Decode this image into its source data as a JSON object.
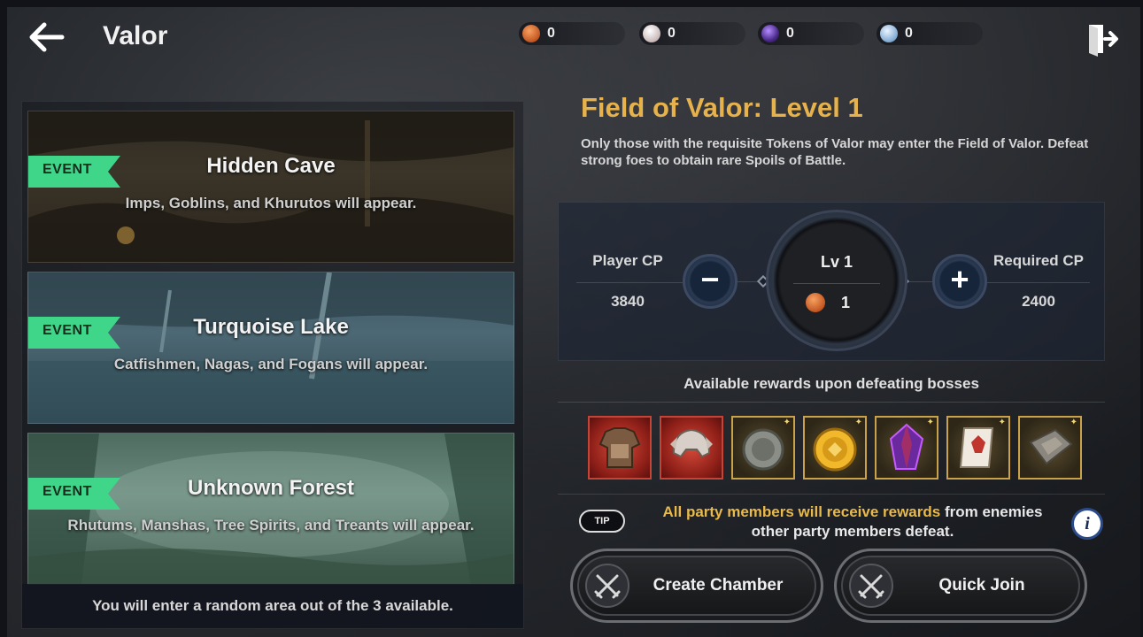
{
  "header": {
    "title": "Valor",
    "currencies": [
      {
        "icon": "valor-token-icon",
        "color": "#d1692b",
        "value": "0"
      },
      {
        "icon": "pearl-icon",
        "color": "#d8c8c8",
        "value": "0"
      },
      {
        "icon": "dark-orb-icon",
        "color": "#4a2a8a",
        "value": "0"
      },
      {
        "icon": "silver-coin-icon",
        "color": "#9fc2e4",
        "value": "0"
      }
    ]
  },
  "areas": [
    {
      "tag": "EVENT",
      "name": "Hidden Cave",
      "desc": "Imps, Goblins, and Khurutos will appear."
    },
    {
      "tag": "EVENT",
      "name": "Turquoise Lake",
      "desc": "Catfishmen, Nagas, and Fogans will appear."
    },
    {
      "tag": "EVENT",
      "name": "Unknown Forest",
      "desc": "Rhutums, Manshas, Tree Spirits, and Treants will appear."
    }
  ],
  "left_footer": "You will enter a random area out of the 3 available.",
  "level": {
    "title": "Field of Valor: Level 1",
    "description": "Only those with the requisite Tokens of Valor may enter the Field of Valor. Defeat strong foes to obtain rare Spoils of Battle.",
    "player_cp_label": "Player CP",
    "player_cp": "3840",
    "required_cp_label": "Required CP",
    "required_cp": "2400",
    "lv_label": "Lv 1",
    "cost": "1",
    "minus": "−",
    "plus": "+"
  },
  "rewards": {
    "title": "Available rewards upon defeating bosses",
    "items": [
      {
        "icon": "armor-chest-icon",
        "rarity": "red"
      },
      {
        "icon": "helmet-icon",
        "rarity": "red"
      },
      {
        "icon": "silver-medal-icon",
        "rarity": "gold"
      },
      {
        "icon": "gold-medal-icon",
        "rarity": "gold"
      },
      {
        "icon": "purple-crystal-icon",
        "rarity": "gold"
      },
      {
        "icon": "scroll-icon",
        "rarity": "gold"
      },
      {
        "icon": "stone-tablet-icon",
        "rarity": "gold"
      }
    ]
  },
  "tip": {
    "badge": "TIP",
    "highlight": "All party members will receive rewards",
    "rest_line1": " from enemies",
    "line2": "other party members defeat."
  },
  "buttons": {
    "create": "Create Chamber",
    "join": "Quick Join"
  },
  "colors": {
    "accent_gold": "#e7b24b",
    "event_green": "#3fd68a"
  }
}
